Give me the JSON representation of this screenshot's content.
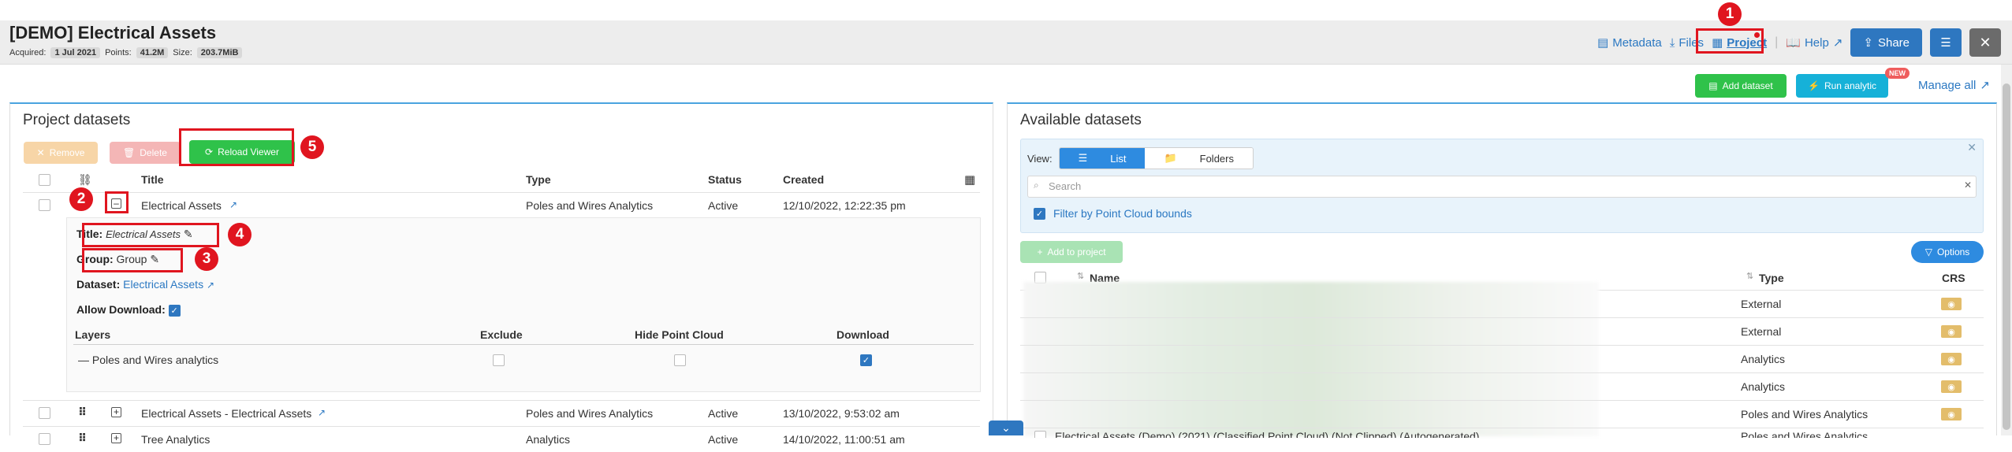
{
  "header": {
    "title": "[DEMO] Electrical Assets",
    "acquired_label": "Acquired:",
    "acquired_value": "1 Jul 2021",
    "points_label": "Points:",
    "points_value": "41.2M",
    "size_label": "Size:",
    "size_value": "203.7MiB",
    "metadata": "Metadata",
    "files": "Files",
    "project": "Project",
    "help": "Help",
    "share": "Share"
  },
  "toolbar": {
    "add_dataset": "Add dataset",
    "run_analytic": "Run analytic",
    "new_badge": "NEW",
    "manage_all": "Manage all"
  },
  "project_panel": {
    "title": "Project datasets",
    "remove": "Remove",
    "delete": "Delete",
    "reload": "Reload Viewer",
    "columns": {
      "title": "Title",
      "type": "Type",
      "status": "Status",
      "created": "Created"
    },
    "rows": [
      {
        "title": "Electrical Assets",
        "type": "Poles and Wires Analytics",
        "status": "Active",
        "created": "12/10/2022, 12:22:35 pm"
      },
      {
        "title": "Electrical Assets - Electrical Assets",
        "type": "Poles and Wires Analytics",
        "status": "Active",
        "created": "13/10/2022, 9:53:02 am"
      },
      {
        "title": "Tree Analytics",
        "type": "Analytics",
        "status": "Active",
        "created": "14/10/2022, 11:00:51 am"
      }
    ],
    "detail": {
      "title_label": "Title:",
      "title_value": "Electrical Assets",
      "group_label": "Group:",
      "group_value": "Group",
      "dataset_label": "Dataset:",
      "dataset_value": "Electrical Assets",
      "allow_download_label": "Allow Download:",
      "layers_col": "Layers",
      "exclude_col": "Exclude",
      "hide_pc_col": "Hide Point Cloud",
      "download_col": "Download",
      "layer_name": "Poles and Wires analytics"
    }
  },
  "available_panel": {
    "title": "Available datasets",
    "view_label": "View:",
    "list": "List",
    "folders": "Folders",
    "search_placeholder": "Search",
    "filter_label": "Filter by Point Cloud bounds",
    "add_to_project": "Add to project",
    "options": "Options",
    "columns": {
      "name": "Name",
      "type": "Type",
      "crs": "CRS"
    },
    "types": [
      "External",
      "External",
      "Analytics",
      "Analytics",
      "Poles and Wires Analytics"
    ],
    "last_row_name": "Electrical Assets (Demo) (2021) (Classified Point Cloud) (Not Clipped) (Autogenerated)",
    "last_row_type": "Poles and Wires Analytics"
  },
  "annotations": [
    "1",
    "2",
    "3",
    "4",
    "5"
  ],
  "colors": {
    "accent": "#2e77c0",
    "highlight": "#e0151f",
    "success": "#2fc24a",
    "info": "#16b1d8"
  }
}
